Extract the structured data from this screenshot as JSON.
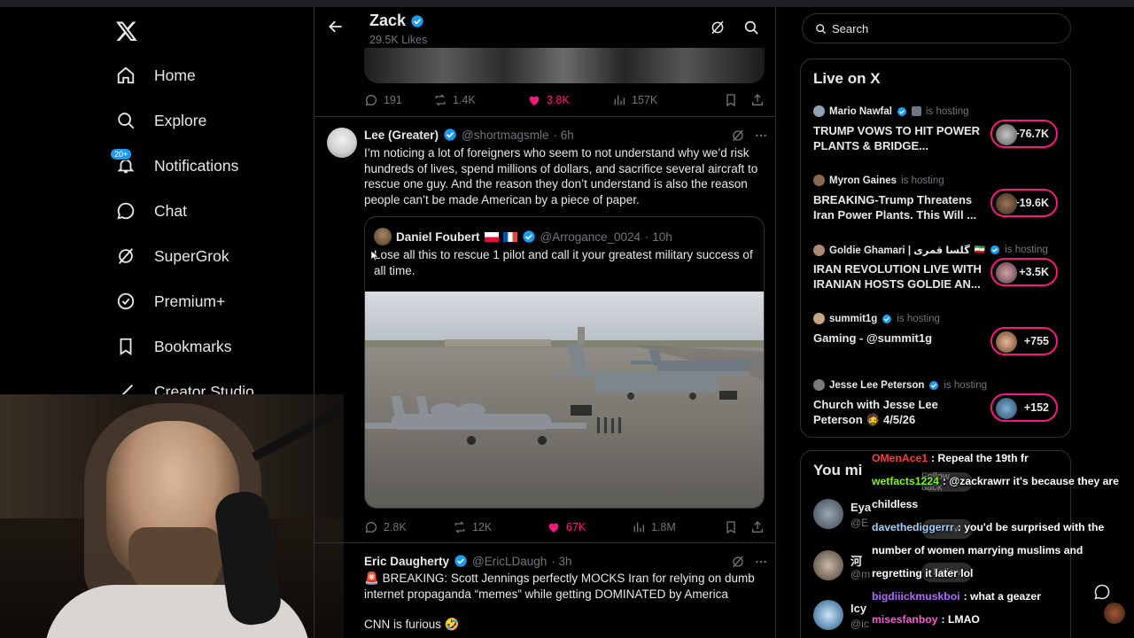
{
  "nav": {
    "items": [
      {
        "label": "Home",
        "icon": "home-icon"
      },
      {
        "label": "Explore",
        "icon": "search-icon"
      },
      {
        "label": "Notifications",
        "icon": "bell-icon",
        "badge": "20+"
      },
      {
        "label": "Chat",
        "icon": "chat-icon"
      },
      {
        "label": "SuperGrok",
        "icon": "grok-icon"
      },
      {
        "label": "Premium+",
        "icon": "premium-icon"
      },
      {
        "label": "Bookmarks",
        "icon": "bookmark-icon"
      },
      {
        "label": "Creator Studio",
        "icon": "creator-studio-icon"
      }
    ]
  },
  "header": {
    "name": "Zack",
    "subtitle": "29.5K Likes"
  },
  "top_tweet_actions": {
    "replies": "191",
    "reposts": "1.4K",
    "likes": "3.8K",
    "views": "157K"
  },
  "tweet1": {
    "name": "Lee (Greater)",
    "handle": "@shortmagsmle",
    "time": "· 6h",
    "text": "I’m noticing a lot of foreigners who seem to not understand why we’d risk hundreds of lives, spend millions of dollars, and sacrifice several aircraft to rescue one guy. And the reason they don’t understand is also the reason people can’t be made American by a piece of paper.",
    "quote": {
      "name": "Daniel Foubert",
      "handle": "@Arrogance_0024",
      "time": "· 10h",
      "text": "Lose all this to rescue 1 pilot and call it your greatest military success of all time."
    },
    "actions": {
      "replies": "2.8K",
      "reposts": "12K",
      "likes": "67K",
      "views": "1.8M"
    }
  },
  "tweet2": {
    "name": "Eric Daugherty",
    "handle": "@EricLDaugh",
    "time": "· 3h",
    "text": "BREAKING: Scott Jennings perfectly MOCKS Iran for relying on dumb internet propaganda “memes” while getting DOMINATED by America",
    "text2": "CNN is furious"
  },
  "search": {
    "placeholder": "Search"
  },
  "live": {
    "title": "Live on X",
    "items": [
      {
        "host": "Mario Nawfal",
        "status": "is hosting",
        "title": "TRUMP VOWS TO HIT POWER PLANTS & BRIDGE...",
        "count": "+76.7K"
      },
      {
        "host": "Myron Gaines",
        "status": "is hosting",
        "title": "BREAKING-Trump Threatens Iran Power Plants. This Will ...",
        "count": "+19.6K"
      },
      {
        "host": "Goldie Ghamari | گلسا قمری",
        "status": "is hosting",
        "title": "IRAN REVOLUTION LIVE WITH IRANIAN HOSTS GOLDIE AN...",
        "count": "+3.5K"
      },
      {
        "host": "summit1g",
        "status": "is hosting",
        "title": "Gaming - @summit1g",
        "count": "+755"
      },
      {
        "host": "Jesse Lee Peterson",
        "status": "is hosting",
        "title": "Church with Jesse Lee Peterson 🧔 4/5/26",
        "count": "+152"
      }
    ]
  },
  "you_might_like": {
    "title": "You mi",
    "rows": [
      {
        "name": "Eya",
        "handle": "@E",
        "button": "Follow back"
      },
      {
        "name": "河",
        "handle": "@m",
        "button": "Follow"
      },
      {
        "name": "Icy",
        "handle": "@ic",
        "button": "Follow"
      }
    ]
  },
  "chat": [
    {
      "user": "OMenAce1",
      "color": "#ff3b3b",
      "msg": "Repeal the 19th fr"
    },
    {
      "user": "wetfacts1224",
      "color": "#7cfc00",
      "msg": "@zackrawrr it's because they are childless"
    },
    {
      "user": "davethediggerrr",
      "color": "#9fd3ff",
      "msg": "you'd be surprised with the number of women marrying muslims and regretting it later lol"
    },
    {
      "user": "bigdiiickmuskboi",
      "color": "#b36bff",
      "msg": "what a geazer"
    },
    {
      "user": "misesfanboy",
      "color": "#ff5ad1",
      "msg": "LMAO"
    }
  ],
  "colors": {
    "accent": "#1d9bf0",
    "like": "#f91880",
    "muted": "#71767b",
    "border": "#2f3336"
  }
}
